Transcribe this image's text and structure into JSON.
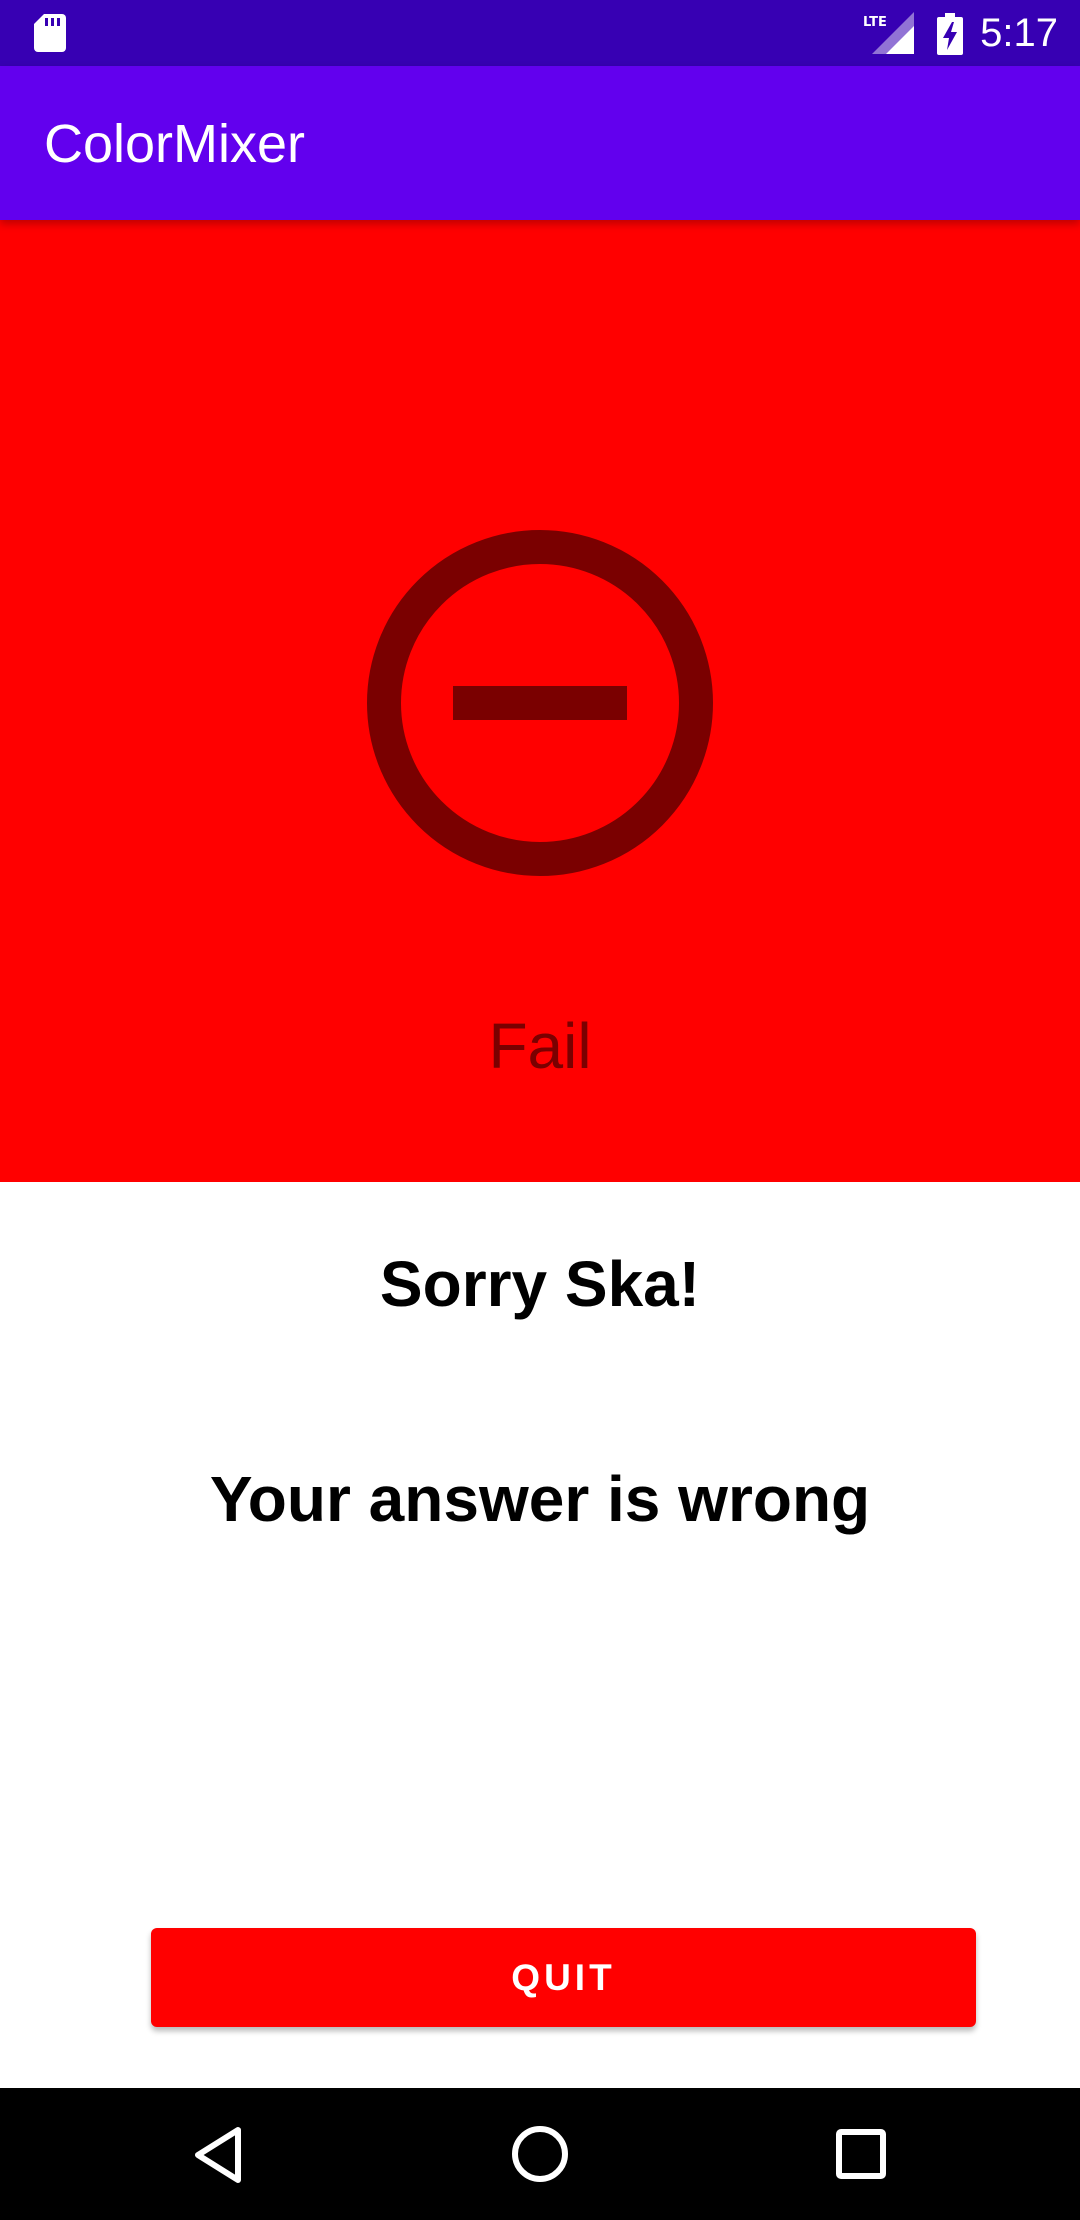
{
  "status_bar": {
    "time": "5:17",
    "network": "LTE",
    "icons": [
      "sd-card-icon",
      "lte-signal-icon",
      "battery-charging-icon"
    ]
  },
  "app_bar": {
    "title": "ColorMixer"
  },
  "result": {
    "icon": "fail-circle-minus-icon",
    "label": "Fail"
  },
  "greeting": "Sorry Ska!",
  "message": "Your answer is wrong",
  "quit_button": {
    "label": "QUIT"
  },
  "nav_bar": {
    "icons": [
      "back-icon",
      "home-icon",
      "recents-icon"
    ]
  },
  "colors": {
    "status_bar": "#3700b3",
    "app_bar": "#6200ee",
    "fail_panel": "#ff0000",
    "fail_icon": "#7a0000",
    "button": "#ff0000"
  }
}
